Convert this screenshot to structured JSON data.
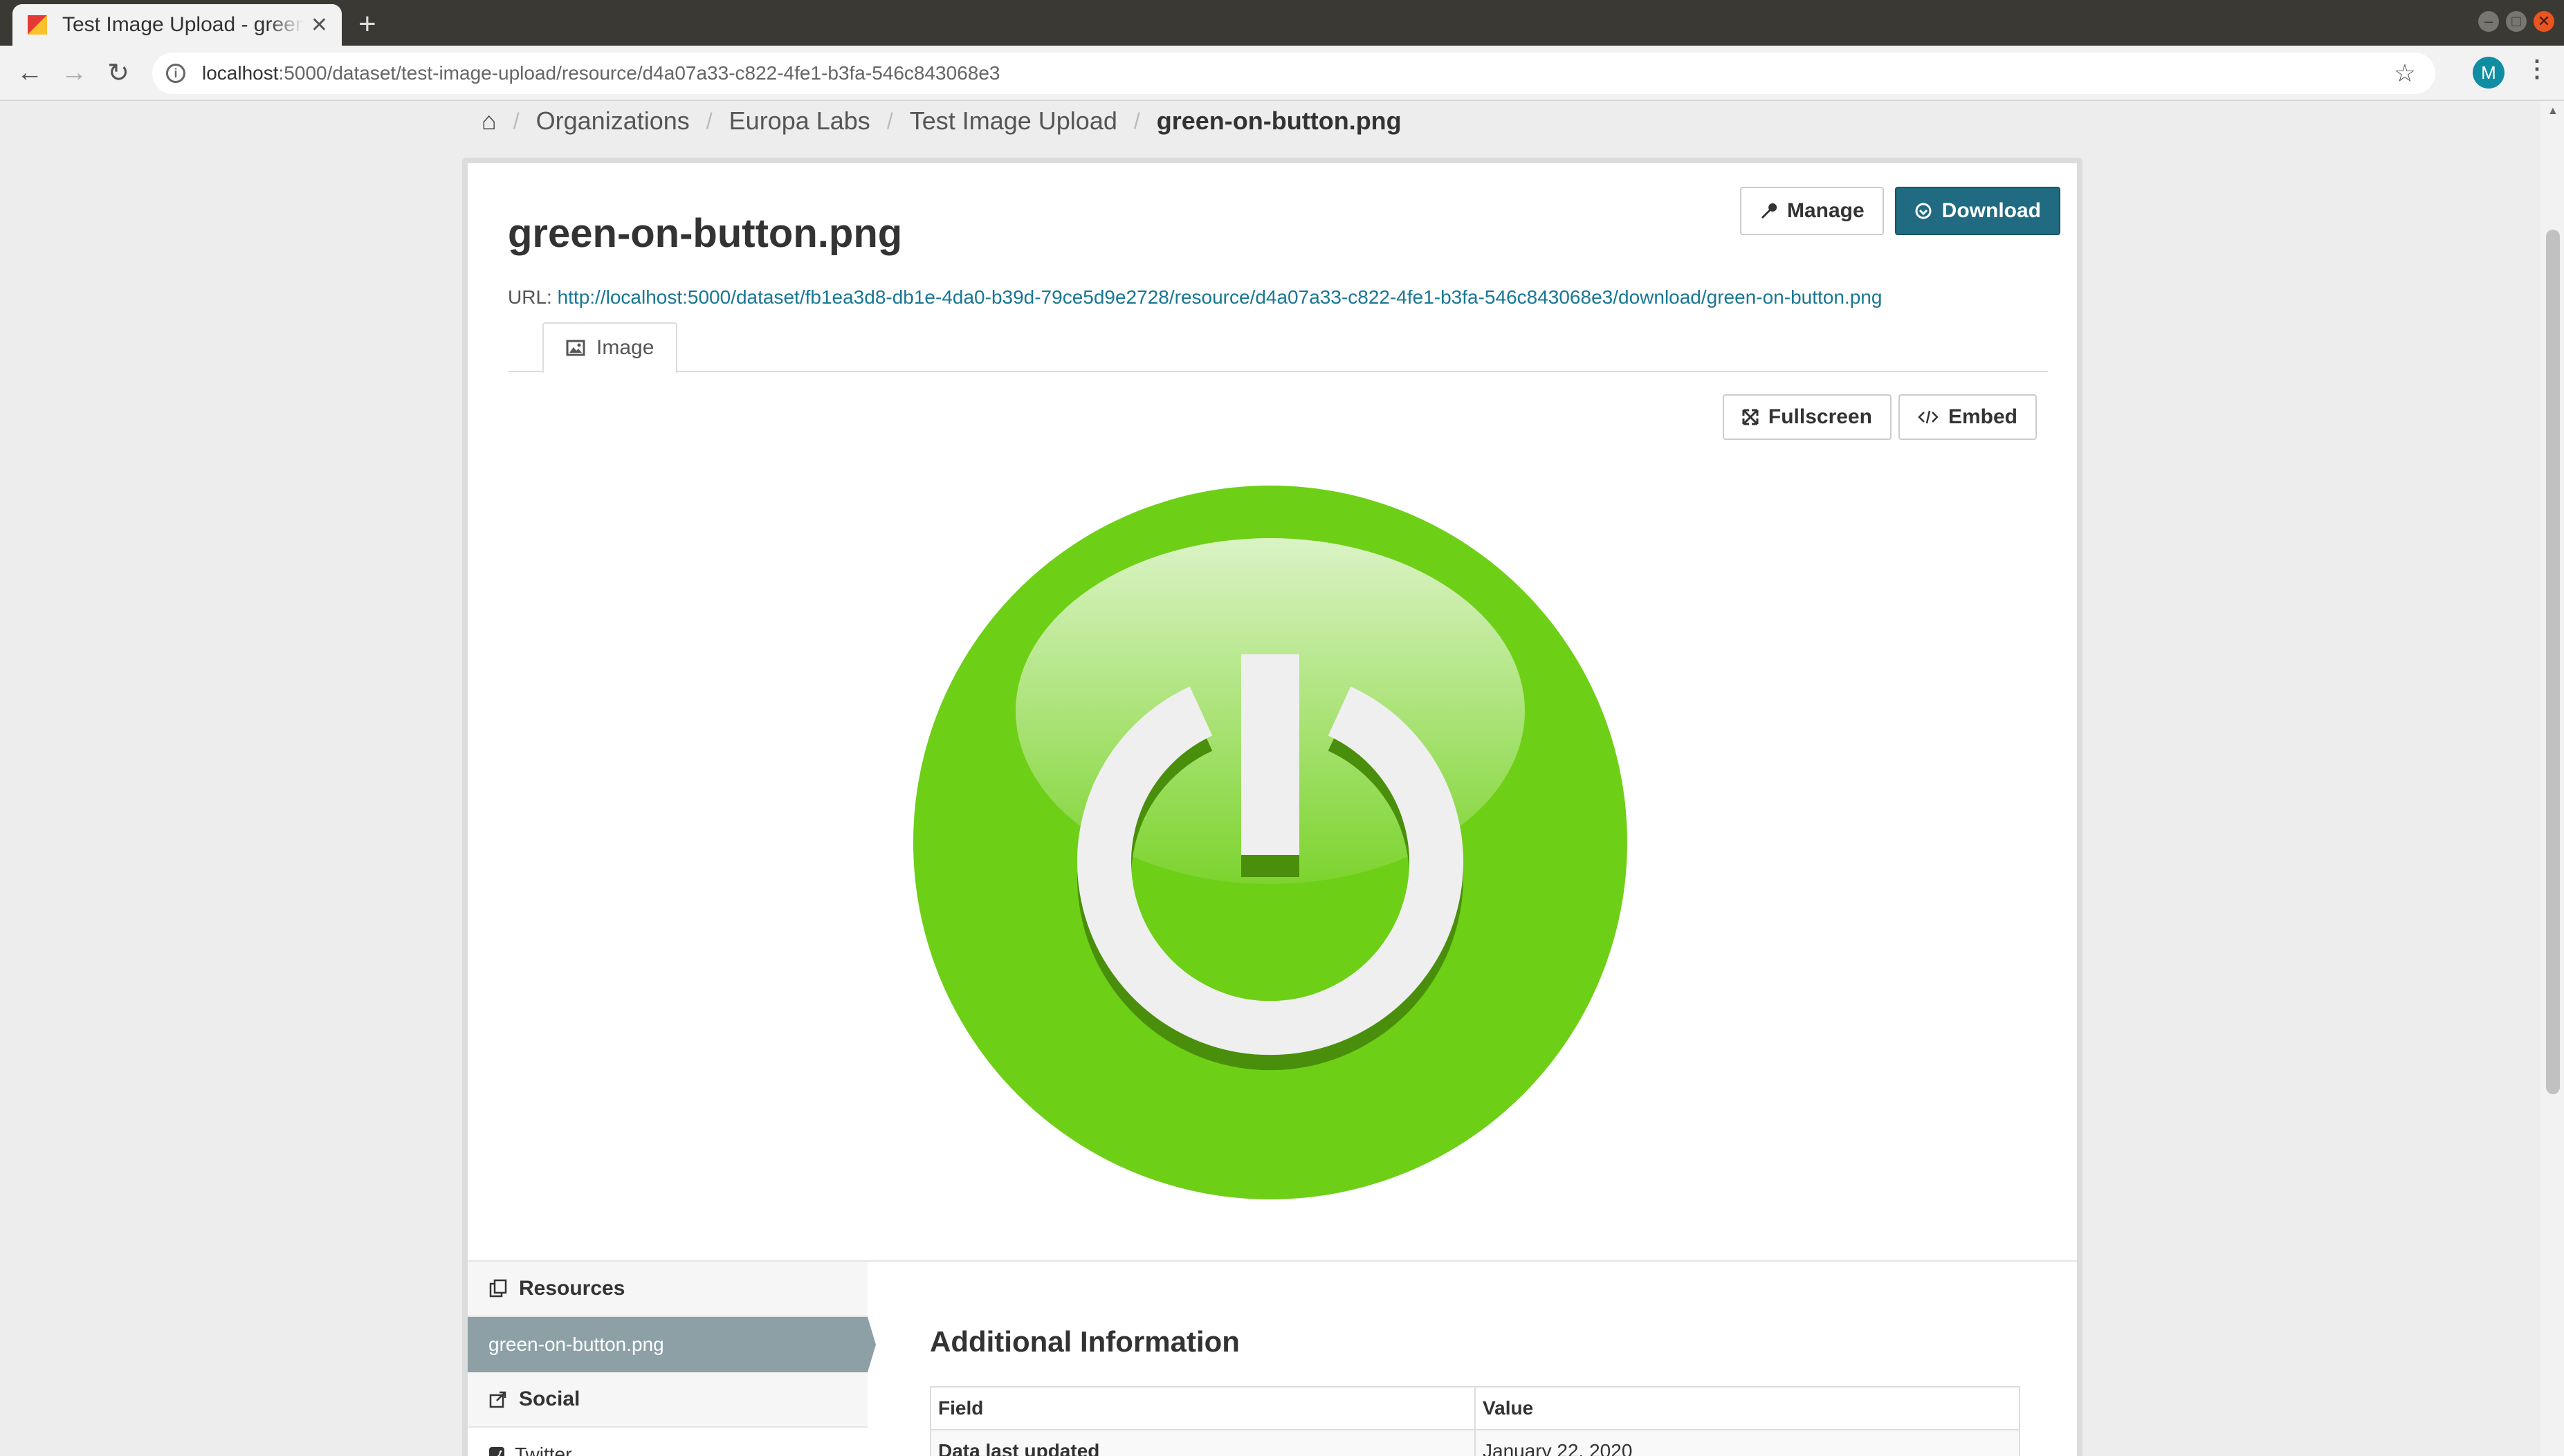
{
  "browser": {
    "tab_title": "Test Image Upload - green-on-button.png",
    "tab_close": "✕",
    "new_tab": "+",
    "url_host": "localhost",
    "url_rest": ":5000/dataset/test-image-upload/resource/d4a07a33-c822-4fe1-b3fa-546c843068e3",
    "profile_initial": "M"
  },
  "breadcrumb": {
    "items": [
      "Organizations",
      "Europa Labs",
      "Test Image Upload"
    ],
    "current": "green-on-button.png"
  },
  "resource": {
    "title": "green-on-button.png",
    "manage_label": "Manage",
    "download_label": "Download",
    "url_label": "URL:",
    "url": "http://localhost:5000/dataset/fb1ea3d8-db1e-4da0-b39d-79ce5d9e2728/resource/d4a07a33-c822-4fe1-b3fa-546c843068e3/download/green-on-button.png"
  },
  "view": {
    "tab_label": "Image",
    "fullscreen_label": "Fullscreen",
    "embed_label": "Embed"
  },
  "sidebar": {
    "resources_heading": "Resources",
    "active_resource": "green-on-button.png",
    "social_heading": "Social",
    "social_items": [
      "Twitter"
    ]
  },
  "additional_info": {
    "title": "Additional Information",
    "headers": [
      "Field",
      "Value"
    ],
    "rows": [
      {
        "field": "Data last updated",
        "value": "January 22, 2020"
      }
    ]
  },
  "colors": {
    "primary_button": "#206b82",
    "link": "#187794",
    "active_sidebar": "#8ca0a6",
    "image_green": "#6ecf17"
  }
}
